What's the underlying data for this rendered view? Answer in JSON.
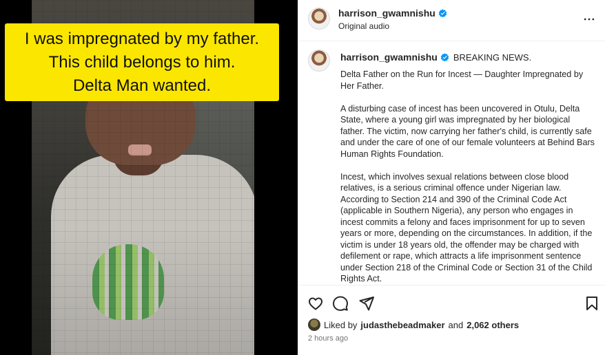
{
  "media": {
    "caption_lines": [
      "I was impregnated by my father.",
      "This child belongs to him.",
      "Delta Man wanted."
    ],
    "caption_bg_color": "#fbe600"
  },
  "header": {
    "username": "harrison_gwamnishu",
    "audio_label": "Original audio",
    "verified_color": "#0095f6",
    "more_icon": "more-horizontal-icon"
  },
  "post": {
    "username": "harrison_gwamnishu",
    "lead": "BREAKING NEWS.",
    "paragraphs": [
      "Delta Father on the Run for Incest — Daughter Impregnated by Her Father.",
      "A disturbing case of incest has been uncovered in Otulu, Delta State, where a young girl was impregnated by her biological father. The victim, now carrying her father's child, is currently safe and under the care of one of our female volunteers at Behind Bars Human Rights Foundation.",
      "Incest, which involves sexual relations between close blood relatives, is a serious criminal offence under Nigerian law. According to Section 214 and 390 of the Criminal Code Act (applicable in Southern Nigeria), any person who engages in incest commits a felony and faces imprisonment for up to seven years or more, depending on the circumstances. In addition, if the victim is under 18 years old, the offender may be charged with defilement or rape, which attracts a life imprisonment sentence under Section 218 of the Criminal Code or Section 31 of the Child Rights Act."
    ]
  },
  "actions": {
    "icons": [
      "heart-icon",
      "comment-icon",
      "share-icon",
      "bookmark-icon"
    ]
  },
  "likes": {
    "prefix": "Liked by",
    "user": "judasthebeadmaker",
    "and": "and",
    "count": "2,062 others"
  },
  "timestamp": "2 hours ago"
}
